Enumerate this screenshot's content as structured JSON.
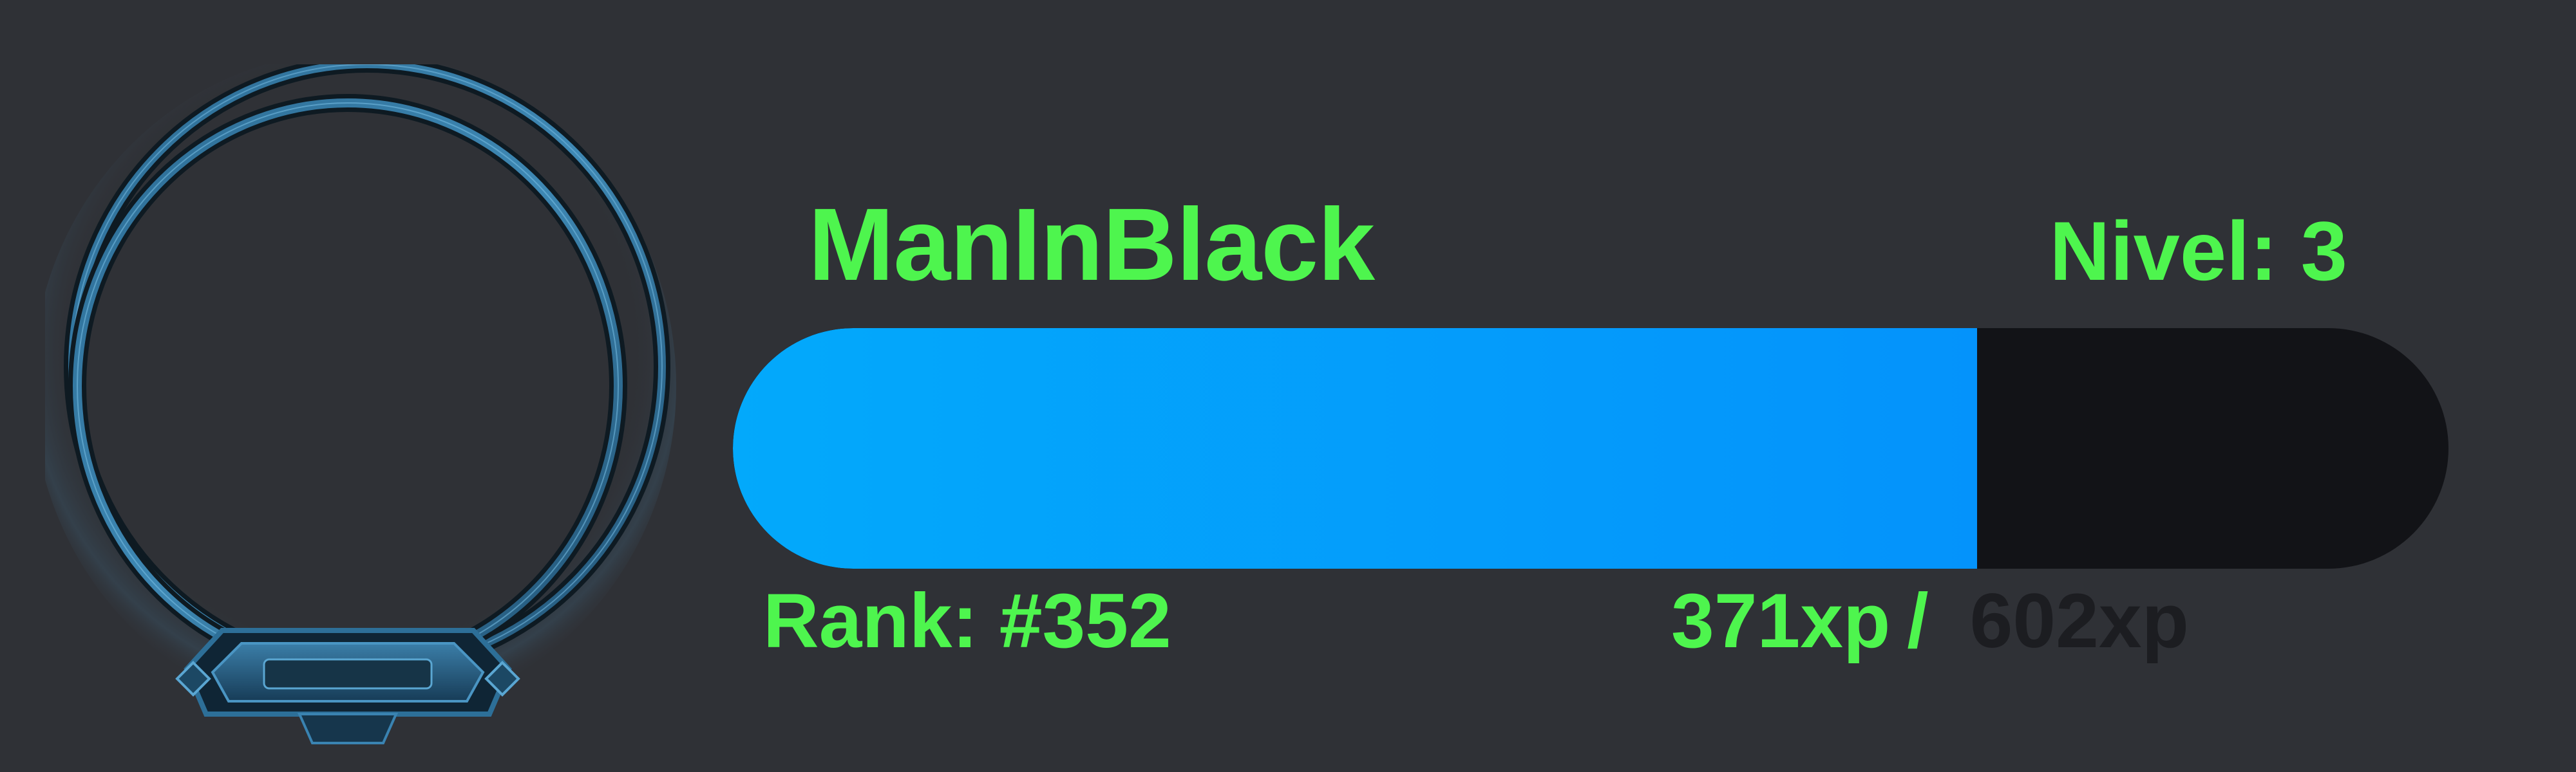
{
  "profile": {
    "username": "ManInBlack",
    "level_text": "Nivel: 3",
    "rank_text": "Rank: #352"
  },
  "xp": {
    "current_text": "371xp",
    "separator_text": "/",
    "needed_text": "602xp",
    "current": 371,
    "needed": 602,
    "progress_fraction": 0.616
  },
  "colors": {
    "background": "#2f3136",
    "accent_text": "#4ef54e",
    "bar_fill": "#0596fb",
    "bar_track": "#121317",
    "muted_text": "#1c1d21",
    "frame": "#3f7fa8"
  },
  "icons": {
    "avatar_frame": "ornate-ring-frame-icon"
  }
}
